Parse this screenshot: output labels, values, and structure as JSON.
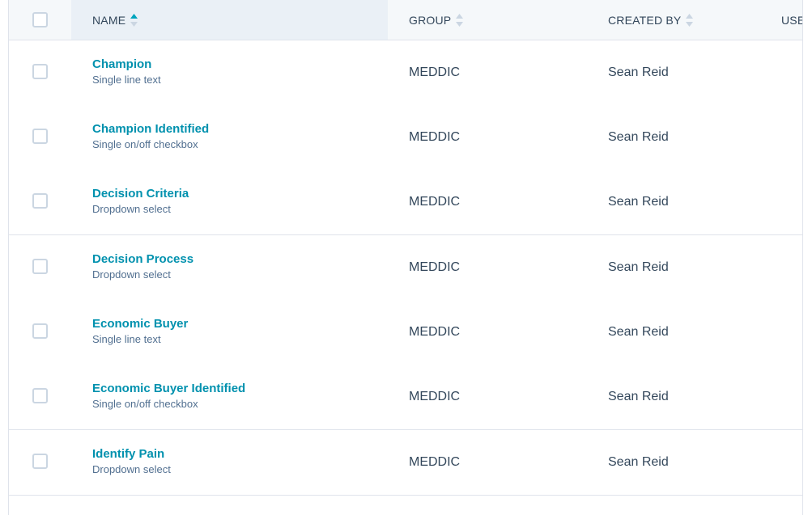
{
  "header": {
    "name": "NAME",
    "group": "GROUP",
    "created_by": "CREATED BY",
    "used_in": "USE"
  },
  "rows": [
    {
      "name": "Champion",
      "type": "Single line text",
      "group": "MEDDIC",
      "created_by": "Sean Reid"
    },
    {
      "name": "Champion Identified",
      "type": "Single on/off checkbox",
      "group": "MEDDIC",
      "created_by": "Sean Reid"
    },
    {
      "name": "Decision Criteria",
      "type": "Dropdown select",
      "group": "MEDDIC",
      "created_by": "Sean Reid"
    },
    {
      "name": "Decision Process",
      "type": "Dropdown select",
      "group": "MEDDIC",
      "created_by": "Sean Reid"
    },
    {
      "name": "Economic Buyer",
      "type": "Single line text",
      "group": "MEDDIC",
      "created_by": "Sean Reid"
    },
    {
      "name": "Economic Buyer Identified",
      "type": "Single on/off checkbox",
      "group": "MEDDIC",
      "created_by": "Sean Reid"
    },
    {
      "name": "Identify Pain",
      "type": "Dropdown select",
      "group": "MEDDIC",
      "created_by": "Sean Reid"
    }
  ],
  "colors": {
    "link": "#0091ae",
    "text": "#33475b",
    "subtext": "#516f90",
    "sort_active": "#00a4bd",
    "sort_inactive": "#cbd6e2"
  }
}
